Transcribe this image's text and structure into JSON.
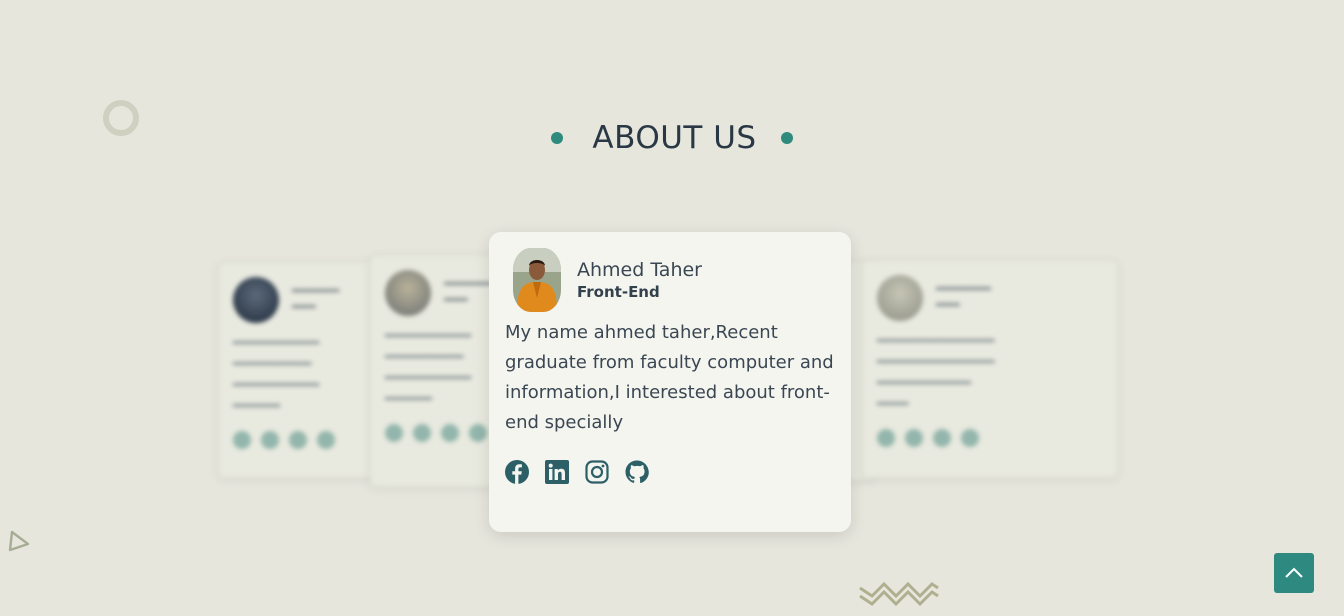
{
  "section": {
    "title": "ABOUT US"
  },
  "colors": {
    "accent": "#2f8a7e",
    "background": "#e6e6dd",
    "card": "#f5f5f0",
    "text": "#2a3845"
  },
  "featured_member": {
    "name": "Ahmed Taher",
    "role": "Front-End",
    "bio": "My name ahmed taher,Recent graduate from faculty computer and information,I interested about front-end specially",
    "socials": [
      {
        "icon": "facebook-icon"
      },
      {
        "icon": "linkedin-icon"
      },
      {
        "icon": "instagram-icon"
      },
      {
        "icon": "github-icon"
      }
    ]
  },
  "scroll_top": {
    "icon": "chevron-up-icon"
  }
}
